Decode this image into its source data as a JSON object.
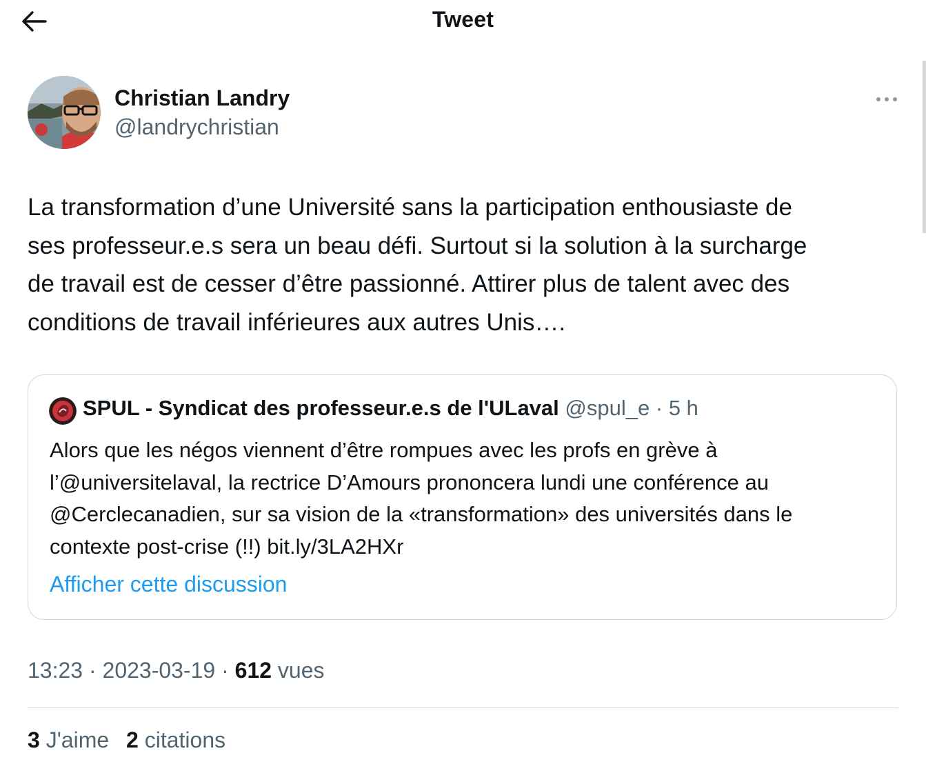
{
  "header": {
    "title": "Tweet",
    "back_icon": "arrow-left-icon"
  },
  "tweet": {
    "author_name": "Christian Landry",
    "author_handle": "@landrychristian",
    "more_icon": "ellipsis-icon",
    "text": "La transformation d’une Université sans la participation enthousiaste de\nses professeur.e.s sera un beau défi. Surtout si la solution à la surcharge\nde travail est de cesser d’être passionné. Attirer plus de talent avec des\nconditions de travail inférieures aux autres Unis…."
  },
  "quote": {
    "author_name": "SPUL - Syndicat des professeur.e.s de l'ULaval",
    "author_handle": "@spul_e",
    "separator": "·",
    "time": "5 h",
    "text": "Alors que les négos viennent d’être rompues avec les profs en grève à\nl’@universitelaval, la rectrice D’Amours prononcera lundi une conférence au\n@Cerclecanadien, sur sa vision de la «transformation» des universités dans le\ncontexte post-crise (!!) bit.ly/3LA2HXr",
    "show_thread": "Afficher cette discussion"
  },
  "meta": {
    "time": "13:23",
    "separator": "·",
    "date": "2023-03-19",
    "views_count": "612",
    "views_label": "vues"
  },
  "stats": {
    "likes_count": "3",
    "likes_label": "J'aime",
    "quotes_count": "2",
    "quotes_label": "citations"
  },
  "colors": {
    "text": "#0f1419",
    "secondary": "#536471",
    "link": "#1d9bf0",
    "border": "#cfd9de"
  }
}
